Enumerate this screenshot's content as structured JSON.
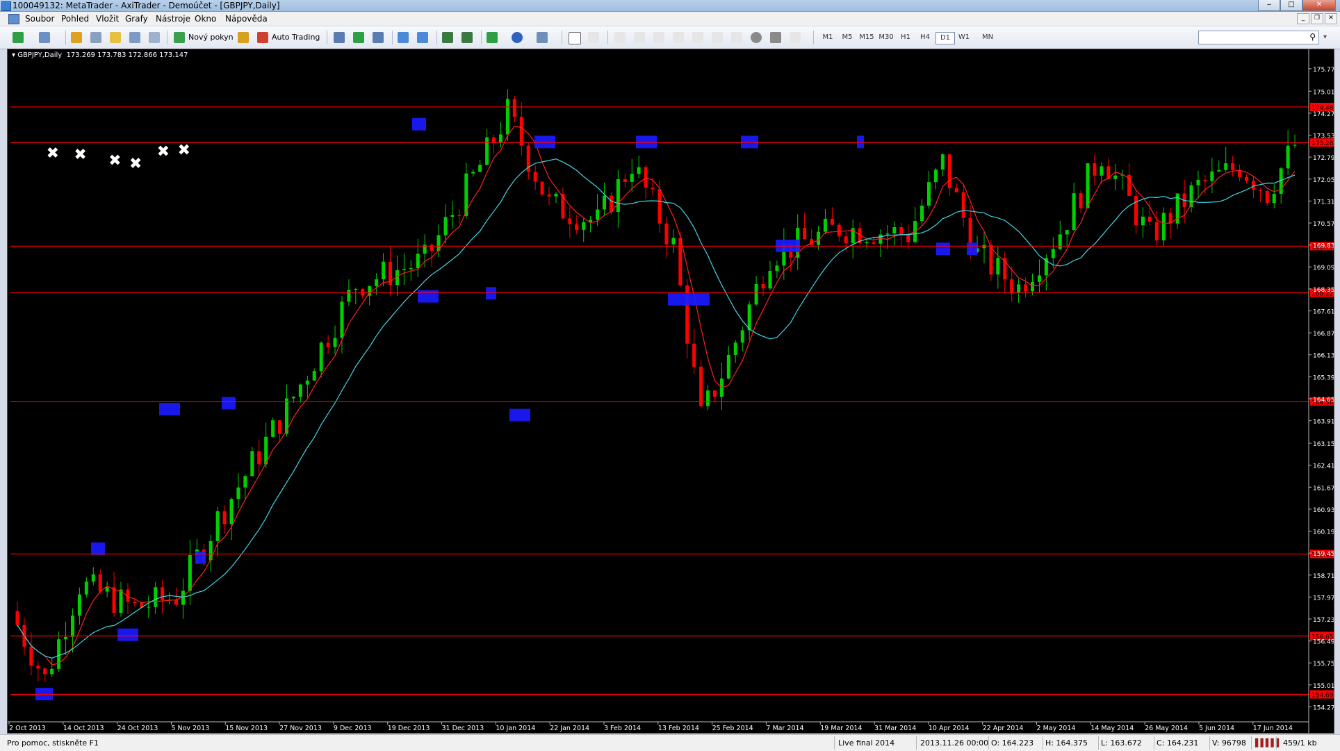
{
  "window": {
    "title": "100049132: MetaTrader - AxiTrader - Demoúčet - [GBPJPY,Daily]"
  },
  "menu": [
    "Soubor",
    "Pohled",
    "Vložit",
    "Grafy",
    "Nástroje",
    "Okno",
    "Nápověda"
  ],
  "toolbar": {
    "new_order": "Nový pokyn",
    "auto_trading": "Auto Trading"
  },
  "timeframes": [
    "M1",
    "M5",
    "M15",
    "M30",
    "H1",
    "H4",
    "D1",
    "W1",
    "MN"
  ],
  "active_timeframe": "D1",
  "chart_data": {
    "type": "candlestick",
    "symbol_header": "GBPJPY,Daily",
    "ohlc_header": "173.269 173.783 172.866 173.147",
    "ylim": [
      154.0,
      176.0
    ],
    "y_ticks": [
      "175.770",
      "175.010",
      "174.270",
      "173.530",
      "172.790",
      "172.050",
      "171.310",
      "170.570",
      "169.830",
      "169.090",
      "168.350",
      "167.610",
      "166.870",
      "166.130",
      "165.390",
      "164.650",
      "163.910",
      "163.150",
      "162.410",
      "161.670",
      "160.930",
      "160.190",
      "159.450",
      "158.710",
      "157.970",
      "157.230",
      "156.490",
      "155.750",
      "155.010",
      "154.270"
    ],
    "x_ticks": [
      "2 Oct 2013",
      "14 Oct 2013",
      "24 Oct 2013",
      "5 Nov 2013",
      "15 Nov 2013",
      "27 Nov 2013",
      "9 Dec 2013",
      "19 Dec 2013",
      "31 Dec 2013",
      "10 Jan 2014",
      "22 Jan 2014",
      "3 Feb 2014",
      "13 Feb 2014",
      "25 Feb 2014",
      "7 Mar 2014",
      "19 Mar 2014",
      "31 Mar 2014",
      "10 Apr 2014",
      "22 Apr 2014",
      "2 May 2014",
      "14 May 2014",
      "26 May 2014",
      "5 Jun 2014",
      "17 Jun 2014"
    ],
    "horizontal_levels": [
      {
        "value": 174.48,
        "label": "174.480"
      },
      {
        "value": 173.28,
        "label": "173.280"
      },
      {
        "value": 169.79,
        "label": "169.799"
      },
      {
        "value": 168.22,
        "label": "168.220"
      },
      {
        "value": 164.56,
        "label": "164.560"
      },
      {
        "value": 159.42,
        "label": "159.416"
      },
      {
        "value": 156.66,
        "label": "156.659"
      },
      {
        "value": 154.69,
        "label": "154.690"
      }
    ],
    "markers": [
      {
        "type": "x",
        "x_index": 5,
        "value": 172.95
      },
      {
        "type": "x",
        "x_index": 9,
        "value": 172.9
      },
      {
        "type": "x",
        "x_index": 14,
        "value": 172.7
      },
      {
        "type": "x",
        "x_index": 17,
        "value": 172.6
      },
      {
        "type": "x",
        "x_index": 21,
        "value": 173.0
      },
      {
        "type": "x",
        "x_index": 24,
        "value": 173.05
      }
    ],
    "moving_averages": [
      {
        "color": "#ff2020"
      },
      {
        "color": "#40d8e8"
      }
    ],
    "colors": {
      "bull": "#00d000",
      "bear": "#ff0000",
      "level": "#ff0000",
      "zone": "#1a1aff",
      "background": "#000000"
    }
  },
  "status": {
    "help": "Pro pomoc, stiskněte F1",
    "profile": "Live final 2014",
    "datetime": "2013.11.26 00:00",
    "open": "O: 164.223",
    "high": "H: 164.375",
    "low": "L: 163.672",
    "close": "C: 164.231",
    "volume": "V: 96798",
    "traffic": "459/1 kb"
  }
}
